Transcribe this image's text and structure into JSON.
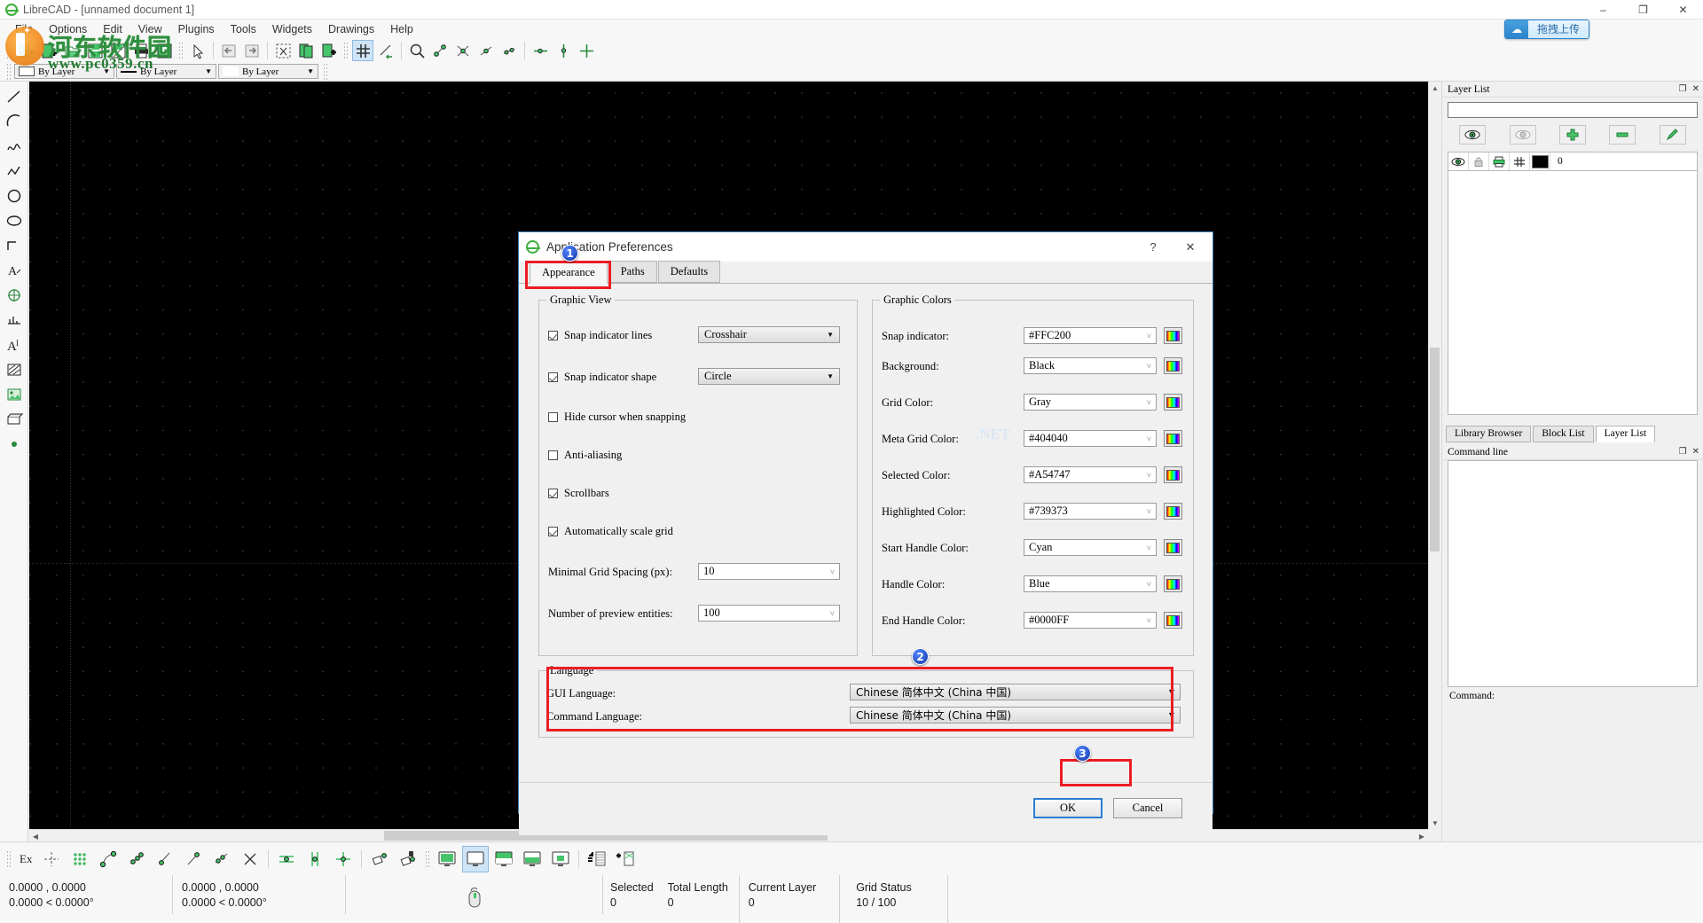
{
  "window": {
    "title": "LibreCAD - [unnamed document 1]",
    "app_icon": "librecad-icon",
    "minimize": "–",
    "maximize": "❐",
    "close": "✕"
  },
  "watermark": {
    "chinese": "河东软件园",
    "url": "www.pc0359.cn"
  },
  "upload": {
    "label": "拖拽上传",
    "icon": "cloud-upload-icon"
  },
  "menu": {
    "items": [
      "File",
      "Options",
      "Edit",
      "View",
      "Plugins",
      "Tools",
      "Widgets",
      "Drawings",
      "Help"
    ]
  },
  "toolbar_attributes": {
    "color": "By Layer",
    "linetype": "By Layer",
    "linewidth": "By Layer"
  },
  "dialog": {
    "title": "Application Preferences",
    "help_btn": "?",
    "close_btn": "✕",
    "tabs": [
      {
        "label": "Appearance",
        "active": true
      },
      {
        "label": "Paths",
        "active": false
      },
      {
        "label": "Defaults",
        "active": false
      }
    ],
    "graphic_view": {
      "legend": "Graphic View",
      "checkboxes": [
        {
          "label": "Snap indicator lines",
          "checked": true,
          "value": "Crosshair"
        },
        {
          "label": "Snap indicator shape",
          "checked": true,
          "value": "Circle"
        },
        {
          "label": "Hide cursor when snapping",
          "checked": false
        },
        {
          "label": "Anti-aliasing",
          "checked": false
        },
        {
          "label": "Scrollbars",
          "checked": true
        },
        {
          "label": "Automatically scale grid",
          "checked": true
        }
      ],
      "spin_fields": [
        {
          "label": "Minimal Grid Spacing (px):",
          "value": "10"
        },
        {
          "label": "Number of preview entities:",
          "value": "100"
        }
      ]
    },
    "graphic_colors": {
      "legend": "Graphic Colors",
      "rows": [
        {
          "label": "Snap indicator:",
          "value": "#FFC200"
        },
        {
          "label": "Background:",
          "value": "Black"
        },
        {
          "label": "Grid Color:",
          "value": "Gray"
        },
        {
          "label": "Meta Grid Color:",
          "value": "#404040"
        },
        {
          "label": "Selected Color:",
          "value": "#A54747"
        },
        {
          "label": "Highlighted Color:",
          "value": "#739373"
        },
        {
          "label": "Start Handle Color:",
          "value": "Cyan"
        },
        {
          "label": "Handle Color:",
          "value": "Blue"
        },
        {
          "label": "End Handle Color:",
          "value": "#0000FF"
        }
      ],
      "picker_icon": "color-picker-icon"
    },
    "language": {
      "legend": "Language",
      "rows": [
        {
          "label": "GUI Language:",
          "value": "Chinese 简体中文 (China 中国)"
        },
        {
          "label": "Command Language:",
          "value": "Chinese 简体中文 (China 中国)"
        }
      ]
    },
    "buttons": {
      "ok": "OK",
      "cancel": "Cancel"
    },
    "annotations": [
      "1",
      "2",
      "3"
    ]
  },
  "layer_panel": {
    "title": "Layer List",
    "filter_value": "",
    "buttons": [
      "show-all-layers-icon",
      "hide-all-layers-icon",
      "add-layer-icon",
      "remove-layer-icon",
      "edit-layer-icon"
    ],
    "rows": [
      {
        "name": "0",
        "visible": true,
        "locked": false,
        "printable": true,
        "construction": false,
        "color": "#000000"
      }
    ]
  },
  "dock_tabs": [
    {
      "label": "Library Browser",
      "active": false
    },
    {
      "label": "Block List",
      "active": false
    },
    {
      "label": "Layer List",
      "active": true
    }
  ],
  "command_panel": {
    "title": "Command line",
    "prompt": "Command:",
    "history": ""
  },
  "statusbar": {
    "snap_mode_label": "Ex",
    "absolute_coord": "0.0000 , 0.0000",
    "absolute_angle": "0.0000 < 0.0000°",
    "relative_coord": "0.0000 , 0.0000",
    "relative_angle": "0.0000 < 0.0000°",
    "fields": [
      {
        "label": "Selected",
        "value": "0"
      },
      {
        "label": "Total Length",
        "value": "0"
      },
      {
        "label": "Current Layer",
        "value": "0"
      },
      {
        "label": "Grid Status",
        "value": "10 / 100"
      }
    ]
  }
}
